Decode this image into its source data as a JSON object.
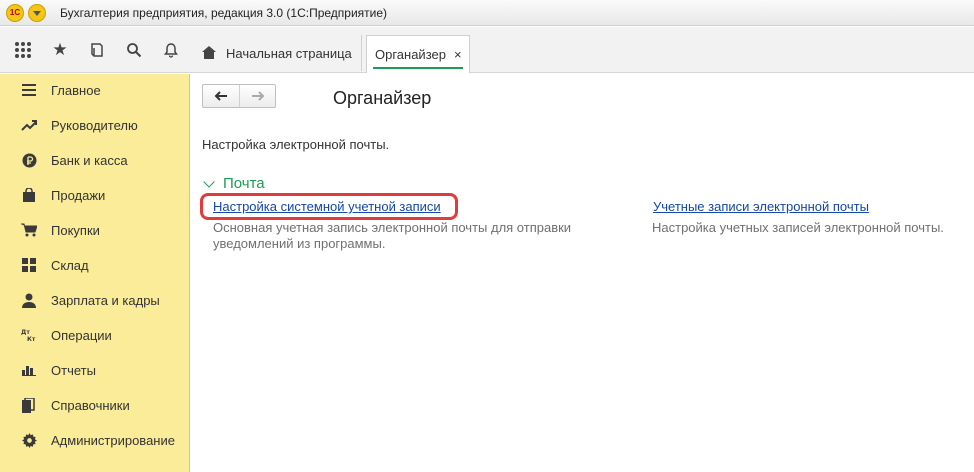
{
  "window": {
    "title": "Бухгалтерия предприятия, редакция 3.0  (1С:Предприятие)",
    "logo_text": "1С"
  },
  "toolbar": {
    "icons": [
      "apps-grid-icon",
      "star-icon",
      "history-icon",
      "search-icon",
      "bell-icon"
    ]
  },
  "tabs": [
    {
      "label": "Начальная страница",
      "icon": "home-icon",
      "active": false
    },
    {
      "label": "Органайзер",
      "active": true,
      "close": "×"
    }
  ],
  "sidebar": {
    "items": [
      {
        "label": "Главное",
        "icon": "menu-lines-icon"
      },
      {
        "label": "Руководителю",
        "icon": "trend-up-icon"
      },
      {
        "label": "Банк и касса",
        "icon": "ruble-icon"
      },
      {
        "label": "Продажи",
        "icon": "shopping-bag-icon"
      },
      {
        "label": "Покупки",
        "icon": "cart-icon"
      },
      {
        "label": "Склад",
        "icon": "warehouse-grid-icon"
      },
      {
        "label": "Зарплата и кадры",
        "icon": "person-icon"
      },
      {
        "label": "Операции",
        "icon": "dt-kt-icon"
      },
      {
        "label": "Отчеты",
        "icon": "bar-chart-icon"
      },
      {
        "label": "Справочники",
        "icon": "books-icon"
      },
      {
        "label": "Администрирование",
        "icon": "gear-icon"
      }
    ]
  },
  "main": {
    "nav": {
      "back": "🡐",
      "forward": "🡒"
    },
    "title": "Органайзер",
    "description": "Настройка электронной почты.",
    "group": {
      "title": "Почта",
      "links": [
        {
          "label": "Настройка системной учетной записи",
          "hint": "Основная учетная запись электронной почты для отправки уведомлений из программы."
        },
        {
          "label": "Учетные записи электронной почты",
          "hint": "Настройка учетных записей электронной почты."
        }
      ]
    }
  },
  "colors": {
    "sidebar_bg": "#fbec9a",
    "accent_green": "#1f9a55",
    "link_blue": "#1447a8",
    "highlight_red": "#e33b3b"
  }
}
